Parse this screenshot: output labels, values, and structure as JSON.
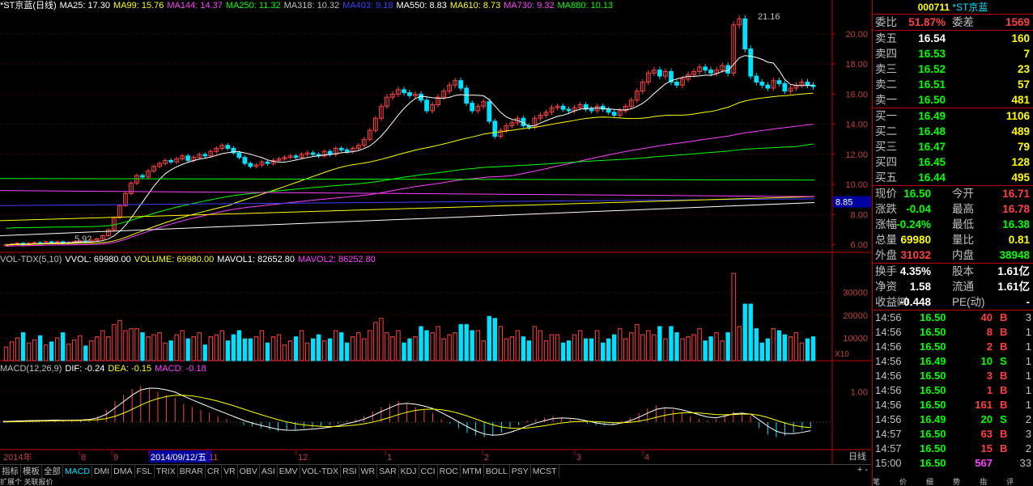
{
  "main_header": [
    {
      "text": "*ST京蓝(日线)",
      "color": "#ffffff"
    },
    {
      "text": "MA25: 17.30",
      "color": "#ffffff"
    },
    {
      "text": "MA99: 15.76",
      "color": "#ffff00"
    },
    {
      "text": "MA144: 14.37",
      "color": "#ff40ff"
    },
    {
      "text": "MA250: 11.32",
      "color": "#00ff00"
    },
    {
      "text": "MA318: 10.32",
      "color": "#c0c0c0"
    },
    {
      "text": "MA403: 9.18",
      "color": "#4040ff"
    },
    {
      "text": "MA550: 8.83",
      "color": "#ffffff"
    },
    {
      "text": "MA610: 8.73",
      "color": "#ffff00"
    },
    {
      "text": "MA730: 9.32",
      "color": "#ff40ff"
    },
    {
      "text": "MA880: 10.13",
      "color": "#00ff00"
    }
  ],
  "vol_header": [
    {
      "text": "VOL-TDX(5,10)",
      "color": "#c0c0c0"
    },
    {
      "text": "VVOL: 69980.00",
      "color": "#ffffff"
    },
    {
      "text": "VOLUME: 69980.00",
      "color": "#ffff00"
    },
    {
      "text": "MAVOL1: 82652.80",
      "color": "#ffffff"
    },
    {
      "text": "MAVOL2: 86252.80",
      "color": "#ff40ff"
    }
  ],
  "macd_header": [
    {
      "text": "MACD(12,26,9)",
      "color": "#c0c0c0"
    },
    {
      "text": "DIF: -0.24",
      "color": "#ffffff"
    },
    {
      "text": "DEA: -0.15",
      "color": "#ffff00"
    },
    {
      "text": "MACD: -0.18",
      "color": "#ff40ff"
    }
  ],
  "price_axis": [
    "20.00",
    "18.00",
    "16.00",
    "14.00",
    "12.00",
    "10.00",
    "8.00",
    "6.00"
  ],
  "vol_axis": [
    "30000",
    "20000",
    "10000"
  ],
  "vol_unit": "X10",
  "macd_axis": [
    "1.00"
  ],
  "price_high_label": "21.16",
  "price_low_label": "5.92",
  "price_tag": "8.85",
  "time_axis": [
    {
      "label": "2014年"
    },
    {
      "label": "8"
    },
    {
      "label": "9"
    },
    {
      "label": "2014/09/12/五"
    },
    {
      "label": "11"
    },
    {
      "label": "12"
    },
    {
      "label": "1"
    },
    {
      "label": "2"
    },
    {
      "label": "3"
    },
    {
      "label": "4"
    }
  ],
  "period": "日线",
  "tabs": [
    "指标",
    "模板",
    "全部",
    "MACD",
    "DMI",
    "DMA",
    "FSL",
    "TRIX",
    "BRAR",
    "CR",
    "VR",
    "OBV",
    "ASI",
    "EMV",
    "VOL-TDX",
    "RSI",
    "WR",
    "SAR",
    "KDJ",
    "CCI",
    "ROC",
    "MTM",
    "BOLL",
    "PSY",
    "MCST"
  ],
  "active_tab": "MACD",
  "zoom_controls": "+ -",
  "bottom_tabs": "扩展个  关联报价",
  "stock": {
    "code": "000711",
    "name": "*ST京蓝"
  },
  "commission": {
    "ratio_label": "委比",
    "ratio": "51.87%",
    "diff_label": "委差",
    "diff": "1569"
  },
  "sell": [
    {
      "label": "卖五",
      "price": "16.54",
      "vol": "160",
      "pc": "#ffffff"
    },
    {
      "label": "卖四",
      "price": "16.53",
      "vol": "7",
      "pc": "#00ff00"
    },
    {
      "label": "卖三",
      "price": "16.52",
      "vol": "23",
      "pc": "#00ff00"
    },
    {
      "label": "卖二",
      "price": "16.51",
      "vol": "57",
      "pc": "#00ff00"
    },
    {
      "label": "卖一",
      "price": "16.50",
      "vol": "481",
      "pc": "#00ff00"
    }
  ],
  "buy": [
    {
      "label": "买一",
      "price": "16.49",
      "vol": "1106",
      "pc": "#00ff00"
    },
    {
      "label": "买二",
      "price": "16.48",
      "vol": "489",
      "pc": "#00ff00"
    },
    {
      "label": "买三",
      "price": "16.47",
      "vol": "79",
      "pc": "#00ff00"
    },
    {
      "label": "买四",
      "price": "16.45",
      "vol": "128",
      "pc": "#00ff00"
    },
    {
      "label": "买五",
      "price": "16.44",
      "vol": "495",
      "pc": "#00ff00"
    }
  ],
  "quote": [
    {
      "l1": "现价",
      "v1": "16.50",
      "c1": "#00ff00",
      "l2": "今开",
      "v2": "16.71",
      "c2": "#ff4040"
    },
    {
      "l1": "涨跌",
      "v1": "-0.04",
      "c1": "#00ff00",
      "l2": "最高",
      "v2": "16.78",
      "c2": "#ff4040"
    },
    {
      "l1": "涨幅",
      "v1": "-0.24%",
      "c1": "#00ff00",
      "l2": "最低",
      "v2": "16.38",
      "c2": "#00ff00"
    },
    {
      "l1": "总量",
      "v1": "69980",
      "c1": "#ffff00",
      "l2": "量比",
      "v2": "0.81",
      "c2": "#ffff00"
    },
    {
      "l1": "外盘",
      "v1": "31032",
      "c1": "#ff4040",
      "l2": "内盘",
      "v2": "38948",
      "c2": "#00ff00"
    }
  ],
  "fund": [
    {
      "l1": "换手",
      "v1": "4.35%",
      "l2": "股本",
      "v2": "1.61亿"
    },
    {
      "l1": "净资",
      "v1": "1.58",
      "l2": "流通",
      "v2": "1.61亿"
    },
    {
      "l1": "收益㈣",
      "v1": "-0.448",
      "l2": "PE(动)",
      "v2": "-"
    }
  ],
  "ticks": [
    {
      "t": "14:56",
      "p": "16.50",
      "pc": "#00ff00",
      "v": "40",
      "f": "B",
      "fc": "#ff4040",
      "c": "3"
    },
    {
      "t": "14:56",
      "p": "16.50",
      "pc": "#00ff00",
      "v": "8",
      "f": "B",
      "fc": "#ff4040",
      "c": "1"
    },
    {
      "t": "14:56",
      "p": "16.50",
      "pc": "#00ff00",
      "v": "2",
      "f": "B",
      "fc": "#ff4040",
      "c": "1"
    },
    {
      "t": "14:56",
      "p": "16.49",
      "pc": "#00ff00",
      "v": "10",
      "f": "S",
      "fc": "#00ff00",
      "c": "1"
    },
    {
      "t": "14:56",
      "p": "16.50",
      "pc": "#00ff00",
      "v": "3",
      "f": "B",
      "fc": "#ff4040",
      "c": "1"
    },
    {
      "t": "14:56",
      "p": "16.50",
      "pc": "#00ff00",
      "v": "1",
      "f": "B",
      "fc": "#ff4040",
      "c": "1"
    },
    {
      "t": "14:56",
      "p": "16.50",
      "pc": "#00ff00",
      "v": "161",
      "f": "B",
      "fc": "#ff4040",
      "c": "1"
    },
    {
      "t": "14:56",
      "p": "16.49",
      "pc": "#00ff00",
      "v": "20",
      "f": "S",
      "fc": "#00ff00",
      "c": "2"
    },
    {
      "t": "14:57",
      "p": "16.50",
      "pc": "#00ff00",
      "v": "63",
      "f": "B",
      "fc": "#ff4040",
      "c": "3"
    },
    {
      "t": "14:57",
      "p": "16.50",
      "pc": "#00ff00",
      "v": "15",
      "f": "B",
      "fc": "#ff4040",
      "c": "2"
    },
    {
      "t": "15:00",
      "p": "16.50",
      "pc": "#00ff00",
      "v": "567",
      "f": "",
      "fc": "#ff40ff",
      "c": "33"
    }
  ],
  "side_tabs": [
    "笔",
    "价",
    "细",
    "势",
    "指",
    "评"
  ],
  "colors": {
    "up": "#ff4040",
    "down": "#00e0ff",
    "frame": "#c00000",
    "bg": "#000000"
  },
  "chart_data": {
    "type": "candlestick",
    "price_ylim": [
      5.5,
      21.5
    ],
    "closes": [
      6.0,
      6.05,
      6.1,
      6.0,
      6.1,
      6.15,
      6.1,
      6.2,
      6.15,
      6.2,
      6.1,
      6.15,
      6.2,
      6.25,
      6.2,
      6.3,
      6.4,
      6.6,
      7.0,
      7.8,
      8.6,
      9.4,
      10.1,
      10.6,
      10.5,
      10.9,
      11.2,
      11.4,
      11.6,
      11.5,
      11.7,
      11.9,
      11.6,
      11.8,
      12.0,
      11.9,
      12.2,
      12.4,
      12.6,
      12.4,
      12.1,
      11.8,
      11.4,
      11.2,
      11.3,
      11.5,
      11.4,
      11.6,
      11.7,
      11.8,
      11.9,
      11.8,
      12.0,
      12.1,
      12.0,
      11.9,
      12.2,
      12.0,
      12.4,
      12.3,
      12.2,
      12.4,
      12.6,
      13.0,
      13.6,
      14.4,
      15.2,
      15.8,
      16.0,
      16.3,
      16.1,
      15.9,
      16.0,
      15.6,
      14.9,
      15.3,
      15.8,
      16.2,
      16.6,
      16.9,
      16.4,
      15.4,
      14.9,
      15.2,
      15.5,
      14.2,
      13.2,
      13.6,
      13.9,
      14.1,
      14.4,
      13.9,
      13.8,
      14.4,
      14.6,
      14.8,
      15.1,
      15.2,
      15.0,
      14.9,
      15.1,
      15.3,
      15.0,
      14.9,
      15.2,
      15.0,
      14.8,
      14.6,
      14.9,
      15.2,
      15.6,
      16.2,
      16.8,
      17.4,
      17.6,
      17.2,
      17.5,
      16.8,
      16.6,
      17.0,
      17.3,
      17.5,
      17.8,
      17.6,
      17.4,
      17.6,
      17.9,
      17.4,
      20.6,
      21.0,
      19.0,
      17.2,
      16.8,
      16.6,
      16.4,
      16.9,
      16.7,
      16.2,
      16.4,
      16.6,
      16.8,
      16.6,
      16.5
    ],
    "macd_hist": [
      0.05,
      0.04,
      0.05,
      0.06,
      0.05,
      0.06,
      0.07,
      0.05,
      0.06,
      0.07,
      0.1,
      0.2,
      0.4,
      0.7,
      0.9,
      1.1,
      1.2,
      1.1,
      1.0,
      0.9,
      0.8,
      0.6,
      0.5,
      0.4,
      0.3,
      0.2,
      0.1,
      0.0,
      -0.1,
      -0.15,
      -0.2,
      -0.25,
      -0.3,
      -0.28,
      -0.25,
      -0.2,
      -0.18,
      -0.15,
      -0.1,
      -0.05,
      0.05,
      0.1,
      0.2,
      0.35,
      0.5,
      0.6,
      0.7,
      0.6,
      0.5,
      0.4,
      0.3,
      0.1,
      -0.05,
      -0.2,
      -0.35,
      -0.45,
      -0.5,
      -0.45,
      -0.35,
      -0.2,
      -0.1,
      0.05,
      0.1,
      0.15,
      0.2,
      0.15,
      0.1,
      0.05,
      -0.05,
      -0.1,
      -0.12,
      -0.1,
      0.05,
      0.15,
      0.3,
      0.45,
      0.55,
      0.5,
      0.4,
      0.3,
      0.2,
      0.1,
      0.05,
      0.1,
      0.25,
      0.35,
      0.3,
      0.2,
      -0.2,
      -0.4,
      -0.5,
      -0.45,
      -0.35,
      -0.25,
      -0.18
    ]
  }
}
